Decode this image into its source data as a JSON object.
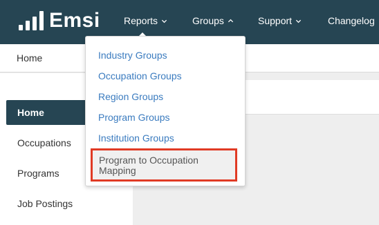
{
  "brand": {
    "name": "Emsi"
  },
  "nav": {
    "items": [
      {
        "label": "Reports",
        "chevron": "chevron-down-icon"
      },
      {
        "label": "Groups",
        "chevron": "chevron-up-icon"
      },
      {
        "label": "Support",
        "chevron": "chevron-down-icon"
      },
      {
        "label": "Changelog"
      }
    ]
  },
  "breadcrumb": {
    "label": "Home"
  },
  "sidebar": {
    "items": [
      {
        "label": "Home",
        "active": true
      },
      {
        "label": "Occupations"
      },
      {
        "label": "Programs"
      },
      {
        "label": "Job Postings"
      }
    ]
  },
  "groups_menu": {
    "items": [
      {
        "label": "Industry Groups"
      },
      {
        "label": "Occupation Groups"
      },
      {
        "label": "Region Groups"
      },
      {
        "label": "Program Groups"
      },
      {
        "label": "Institution Groups"
      },
      {
        "label": "Program to Occupation Mapping",
        "highlighted": true
      }
    ]
  },
  "colors": {
    "topbar": "#264553",
    "link": "#3a7bbf",
    "highlight_border": "#e03a24"
  }
}
